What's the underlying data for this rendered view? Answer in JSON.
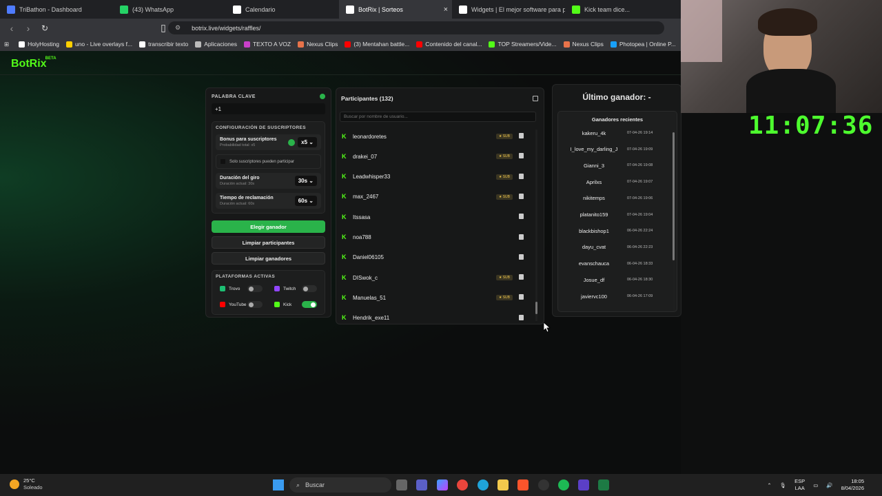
{
  "browser": {
    "tabs": [
      {
        "label": "TriBathon - Dashboard",
        "color": "#4f7cff",
        "active": false
      },
      {
        "label": "(43) WhatsApp",
        "color": "#25d366",
        "active": false
      },
      {
        "label": "Calendario",
        "color": "#ffffff",
        "active": false
      },
      {
        "label": "BotRix | Sorteos",
        "color": "#ffffff",
        "active": true
      },
      {
        "label": "Widgets | El mejor software para pot",
        "color": "#ffffff",
        "active": false
      },
      {
        "label": "Kick team dice...",
        "color": "#53fc18",
        "active": false
      }
    ],
    "url": "botrix.live/widgets/raffles/",
    "bookmarks": [
      {
        "label": "HolyHosting",
        "color": "#ffffff"
      },
      {
        "label": "uno - Live overlays f...",
        "color": "#ffd000"
      },
      {
        "label": "transcribir texto",
        "color": "#ffffff"
      },
      {
        "label": "Aplicaciones",
        "color": "#bbbbbb"
      },
      {
        "label": "TEXTO A VOZ",
        "color": "#c940c9"
      },
      {
        "label": "Nexus Clips",
        "color": "#e8734a"
      },
      {
        "label": "(3) Mentahan battle...",
        "color": "#ff0000"
      },
      {
        "label": "Contenido del canal...",
        "color": "#ff0000"
      },
      {
        "label": "TOP Streamers/Vide...",
        "color": "#53fc18"
      },
      {
        "label": "Nexus Clips",
        "color": "#e8734a"
      },
      {
        "label": "Photopea | Online P...",
        "color": "#18a0fb"
      }
    ]
  },
  "app": {
    "logo": "BotRix",
    "logo_badge": "BETA"
  },
  "config": {
    "keyword_label": "PALABRA CLAVE",
    "keyword_value": "+1",
    "subs_section": "CONFIGURACIÓN DE SUSCRIPTORES",
    "bonus_title": "Bonus para suscriptores",
    "bonus_sub": "Probabilidad total: x5",
    "bonus_value": "x5",
    "only_subs": "Solo suscriptores pueden participar",
    "spin_title": "Duración del giro",
    "spin_sub": "Duración actual: 30s",
    "spin_value": "30s",
    "claim_title": "Tiempo de reclamación",
    "claim_sub": "Duración actual: 60s",
    "claim_value": "60s",
    "pick_winner": "Elegir ganador",
    "clear_participants": "Limpiar participantes",
    "clear_winners": "Limpiar ganadores",
    "platforms_label": "PLATAFORMAS ACTIVAS",
    "platforms": [
      {
        "name": "Trovo",
        "on": false,
        "color": "#1dbf73"
      },
      {
        "name": "Twitch",
        "on": false,
        "color": "#9146ff"
      },
      {
        "name": "YouTube",
        "on": false,
        "color": "#ff0000"
      },
      {
        "name": "Kick",
        "on": true,
        "color": "#53fc18"
      }
    ]
  },
  "participants": {
    "title": "Participantes (132)",
    "search_placeholder": "Buscar por nombre de usuario...",
    "sub_badge": "★ SUB",
    "list": [
      {
        "name": "leonardoretes",
        "sub": true
      },
      {
        "name": "drakei_07",
        "sub": true
      },
      {
        "name": "Leadwhisper33",
        "sub": true
      },
      {
        "name": "max_2467",
        "sub": true
      },
      {
        "name": "Itssasa",
        "sub": false
      },
      {
        "name": "noa788",
        "sub": false
      },
      {
        "name": "Daniel06105",
        "sub": false
      },
      {
        "name": "DISwok_c",
        "sub": true
      },
      {
        "name": "Manuelas_51",
        "sub": true
      },
      {
        "name": "Hendrik_exe11",
        "sub": false
      }
    ]
  },
  "winners": {
    "last_winner": "Último ganador: -",
    "recent_title": "Ganadores recientes",
    "list": [
      {
        "name": "kakeru_4k",
        "date": "07-04-26 19:14"
      },
      {
        "name": "I_love_my_darling_J",
        "date": "07-04-26 19:09"
      },
      {
        "name": "Gianni_3",
        "date": "07-04-26 19:08"
      },
      {
        "name": "Aprilxs",
        "date": "07-04-26 19:07"
      },
      {
        "name": "nikitemps",
        "date": "07-04-26 19:06"
      },
      {
        "name": "platanito159",
        "date": "07-04-26 19:04"
      },
      {
        "name": "blackbishop1",
        "date": "06-04-26 22:24"
      },
      {
        "name": "dayu_cvat",
        "date": "06-04-26 22:23"
      },
      {
        "name": "evanschauca",
        "date": "06-04-26 18:33"
      },
      {
        "name": "Josue_df",
        "date": "06-04-26 18:30"
      },
      {
        "name": "javiervc100",
        "date": "06-04-26 17:09"
      }
    ]
  },
  "overlay": {
    "clock": "11:07:36"
  },
  "taskbar": {
    "temp": "25°C",
    "weather": "Soleado",
    "search": "Buscar",
    "lang1": "ESP",
    "lang2": "LAA",
    "time": "18:05",
    "date": "8/04/2026"
  }
}
